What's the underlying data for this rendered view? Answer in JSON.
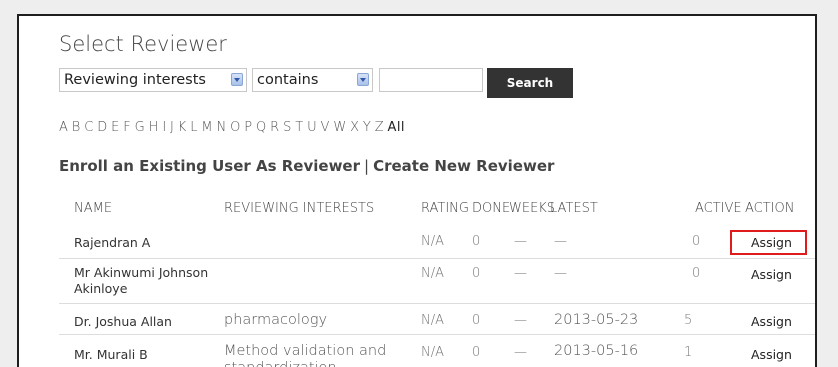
{
  "title": "Select Reviewer",
  "filter": {
    "field_selected": "Reviewing interests",
    "operator_selected": "contains",
    "query_value": "",
    "search_label": "Search"
  },
  "alphabet": [
    "A",
    "B",
    "C",
    "D",
    "E",
    "F",
    "G",
    "H",
    "I",
    "J",
    "K",
    "L",
    "M",
    "N",
    "O",
    "P",
    "Q",
    "R",
    "S",
    "T",
    "U",
    "V",
    "W",
    "X",
    "Y",
    "Z"
  ],
  "alphabet_all": "All",
  "links": {
    "enroll": "Enroll an Existing User As Reviewer",
    "separator": "|",
    "create": "Create New Reviewer"
  },
  "table": {
    "columns": {
      "name": "NAME",
      "interests": "REVIEWING INTERESTS",
      "rating": "RATING",
      "done": "DONE",
      "weeks": "WEEKS",
      "latest": "LATEST",
      "active": "ACTIVE",
      "action": "ACTION"
    },
    "rows": [
      {
        "name": "Rajendran A",
        "name2": "",
        "interests": "",
        "interests2": "",
        "rating": "N/A",
        "done": "0",
        "weeks": "—",
        "latest": "—",
        "active": "0",
        "action": "Assign"
      },
      {
        "name": "Mr Akinwumi Johnson",
        "name2": "Akinloye",
        "interests": "",
        "interests2": "",
        "rating": "N/A",
        "done": "0",
        "weeks": "—",
        "latest": "—",
        "active": "0",
        "action": "Assign"
      },
      {
        "name": "Dr. Joshua Allan",
        "name2": "",
        "interests": "pharmacology",
        "interests2": "",
        "rating": "N/A",
        "done": "0",
        "weeks": "—",
        "latest": "2013-05-23",
        "active": "5",
        "action": "Assign"
      },
      {
        "name": "Mr. Murali B",
        "name2": "",
        "interests": "Method validation and",
        "interests2": "standardization",
        "rating": "N/A",
        "done": "0",
        "weeks": "—",
        "latest": "2013-05-16",
        "active": "1",
        "action": "Assign"
      }
    ]
  },
  "colors": {
    "search_button_bg": "#333333",
    "highlight": "#e01b1b"
  }
}
